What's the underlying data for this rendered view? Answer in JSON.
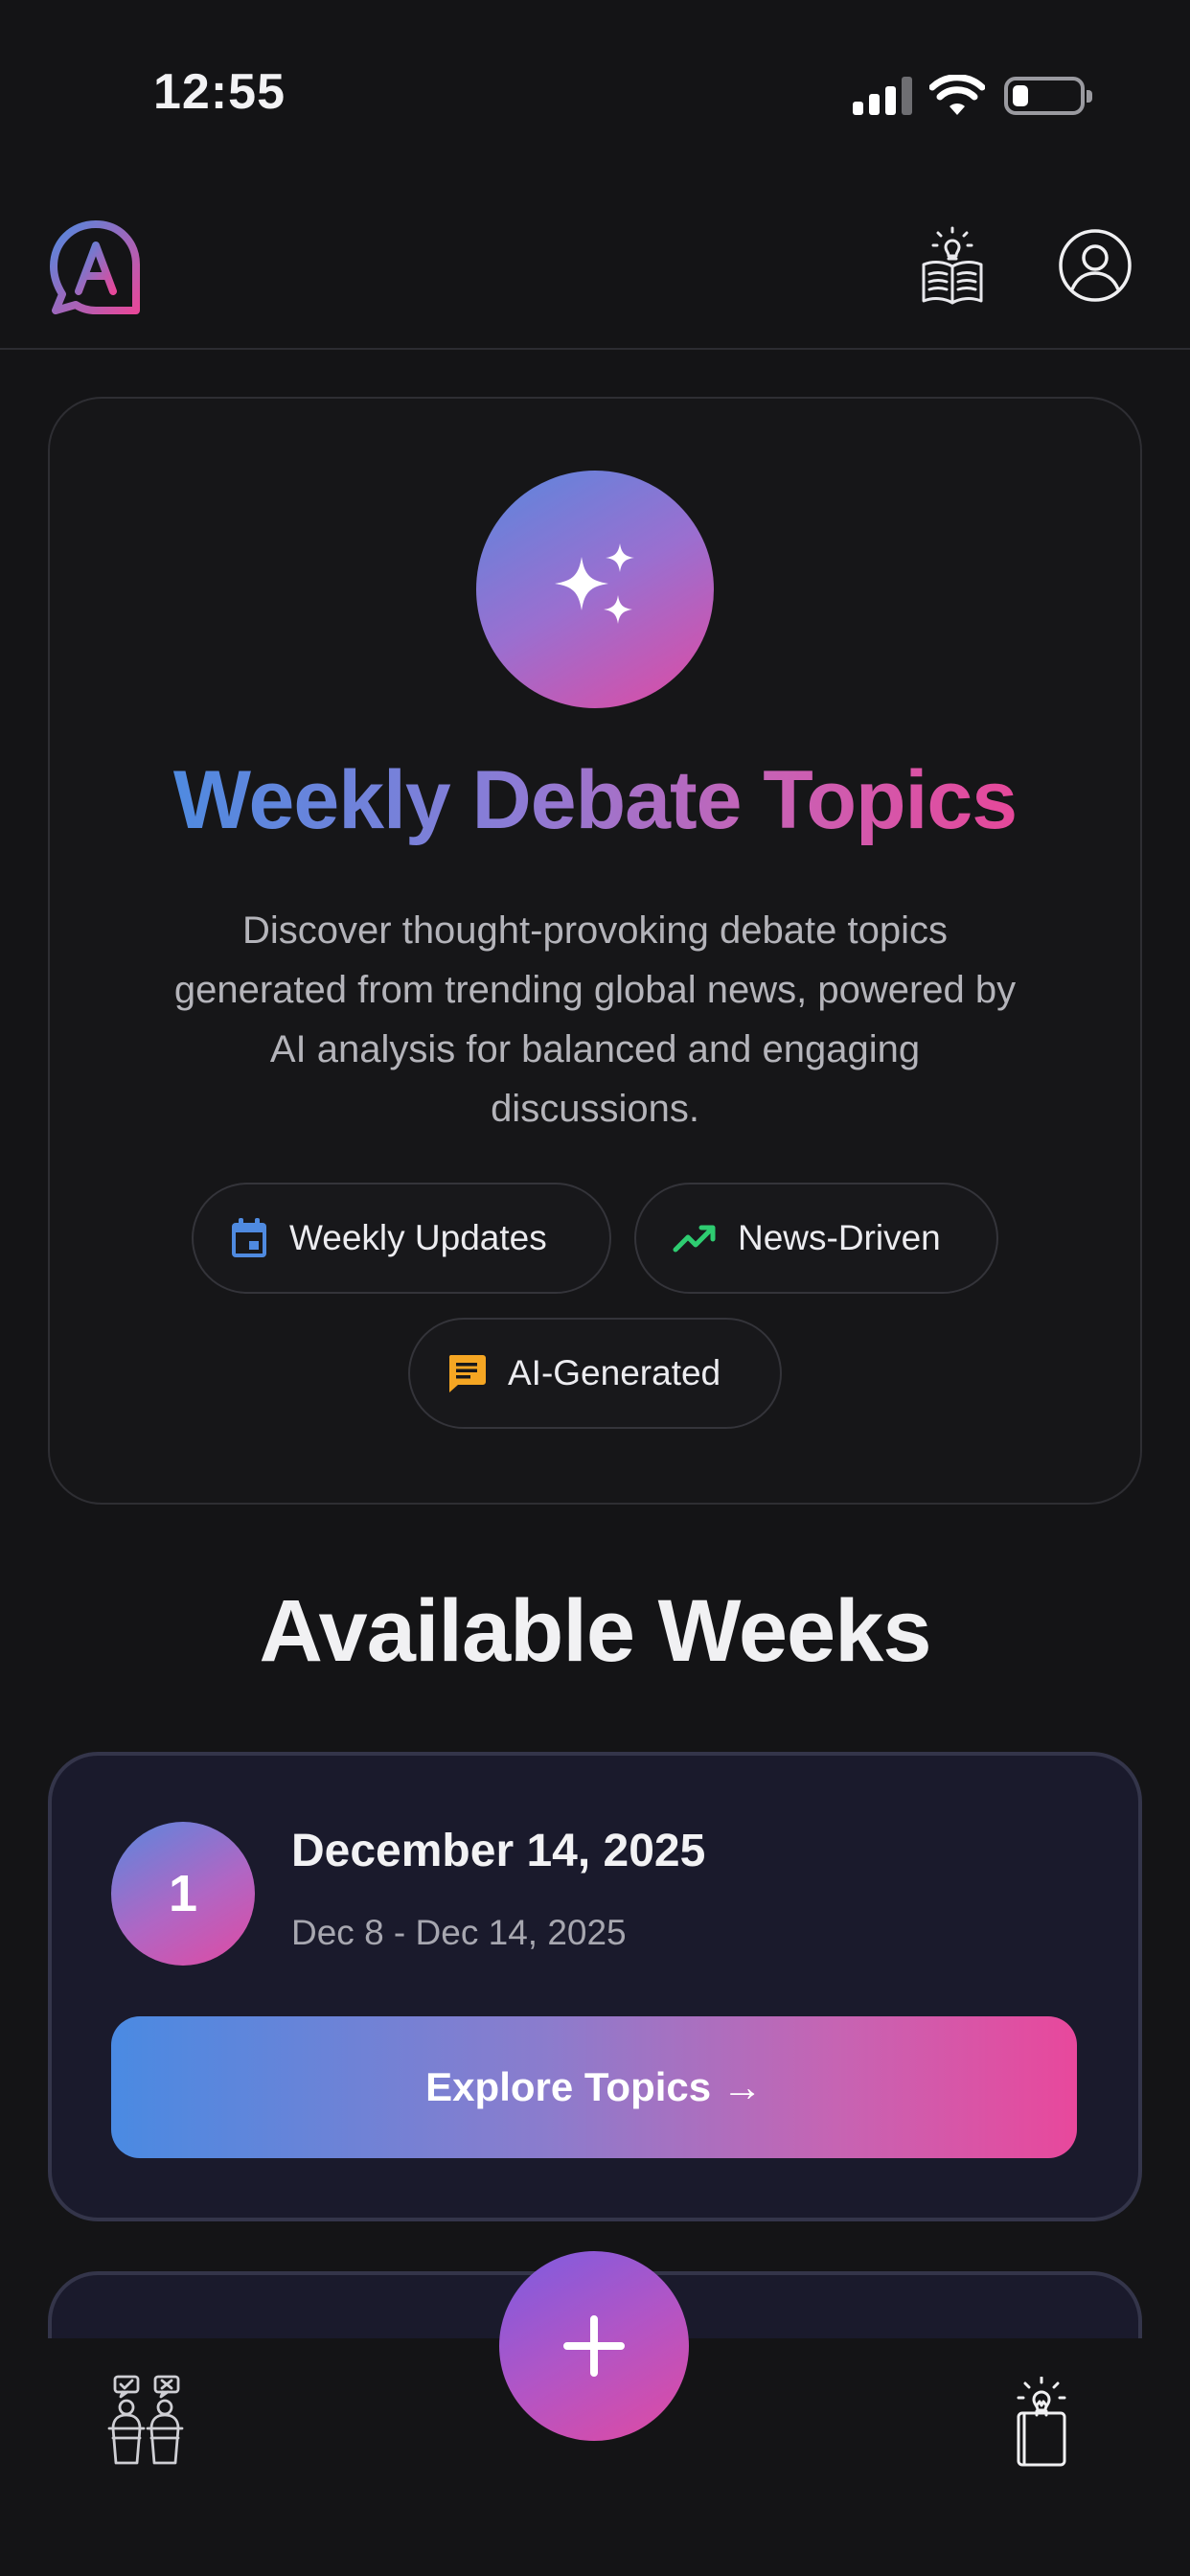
{
  "status_bar": {
    "time": "12:55"
  },
  "header": {
    "logo_icon": "speech-bubble-a-logo-icon",
    "book_icon": "lightbulb-book-icon",
    "profile_icon": "profile-icon"
  },
  "hero": {
    "icon": "sparkles-icon",
    "title": "Weekly Debate Topics",
    "description": "Discover thought-provoking debate topics generated from trending global news, powered by AI analysis for balanced and engaging discussions.",
    "features": [
      {
        "label": "Weekly Updates",
        "icon": "calendar-icon",
        "color": "#4f8ae0"
      },
      {
        "label": "News-Driven",
        "icon": "trending-up-icon",
        "color": "#2ecc71"
      },
      {
        "label": "AI-Generated",
        "icon": "chat-icon",
        "color": "#f5a623"
      }
    ]
  },
  "weeks_section": {
    "title": "Available Weeks",
    "weeks": [
      {
        "number": "1",
        "title": "December 14, 2025",
        "range": "Dec 8 - Dec 14, 2025",
        "button_label": "Explore Topics →"
      }
    ]
  },
  "tab_bar": {
    "left_icon": "debate-podiums-icon",
    "center_icon": "plus-icon",
    "right_icon": "lightbulb-book-icon"
  },
  "colors": {
    "background": "#141416",
    "gradient_start": "#4f8ae0",
    "gradient_end": "#e6489a",
    "card_background": "#1a1a2c"
  }
}
